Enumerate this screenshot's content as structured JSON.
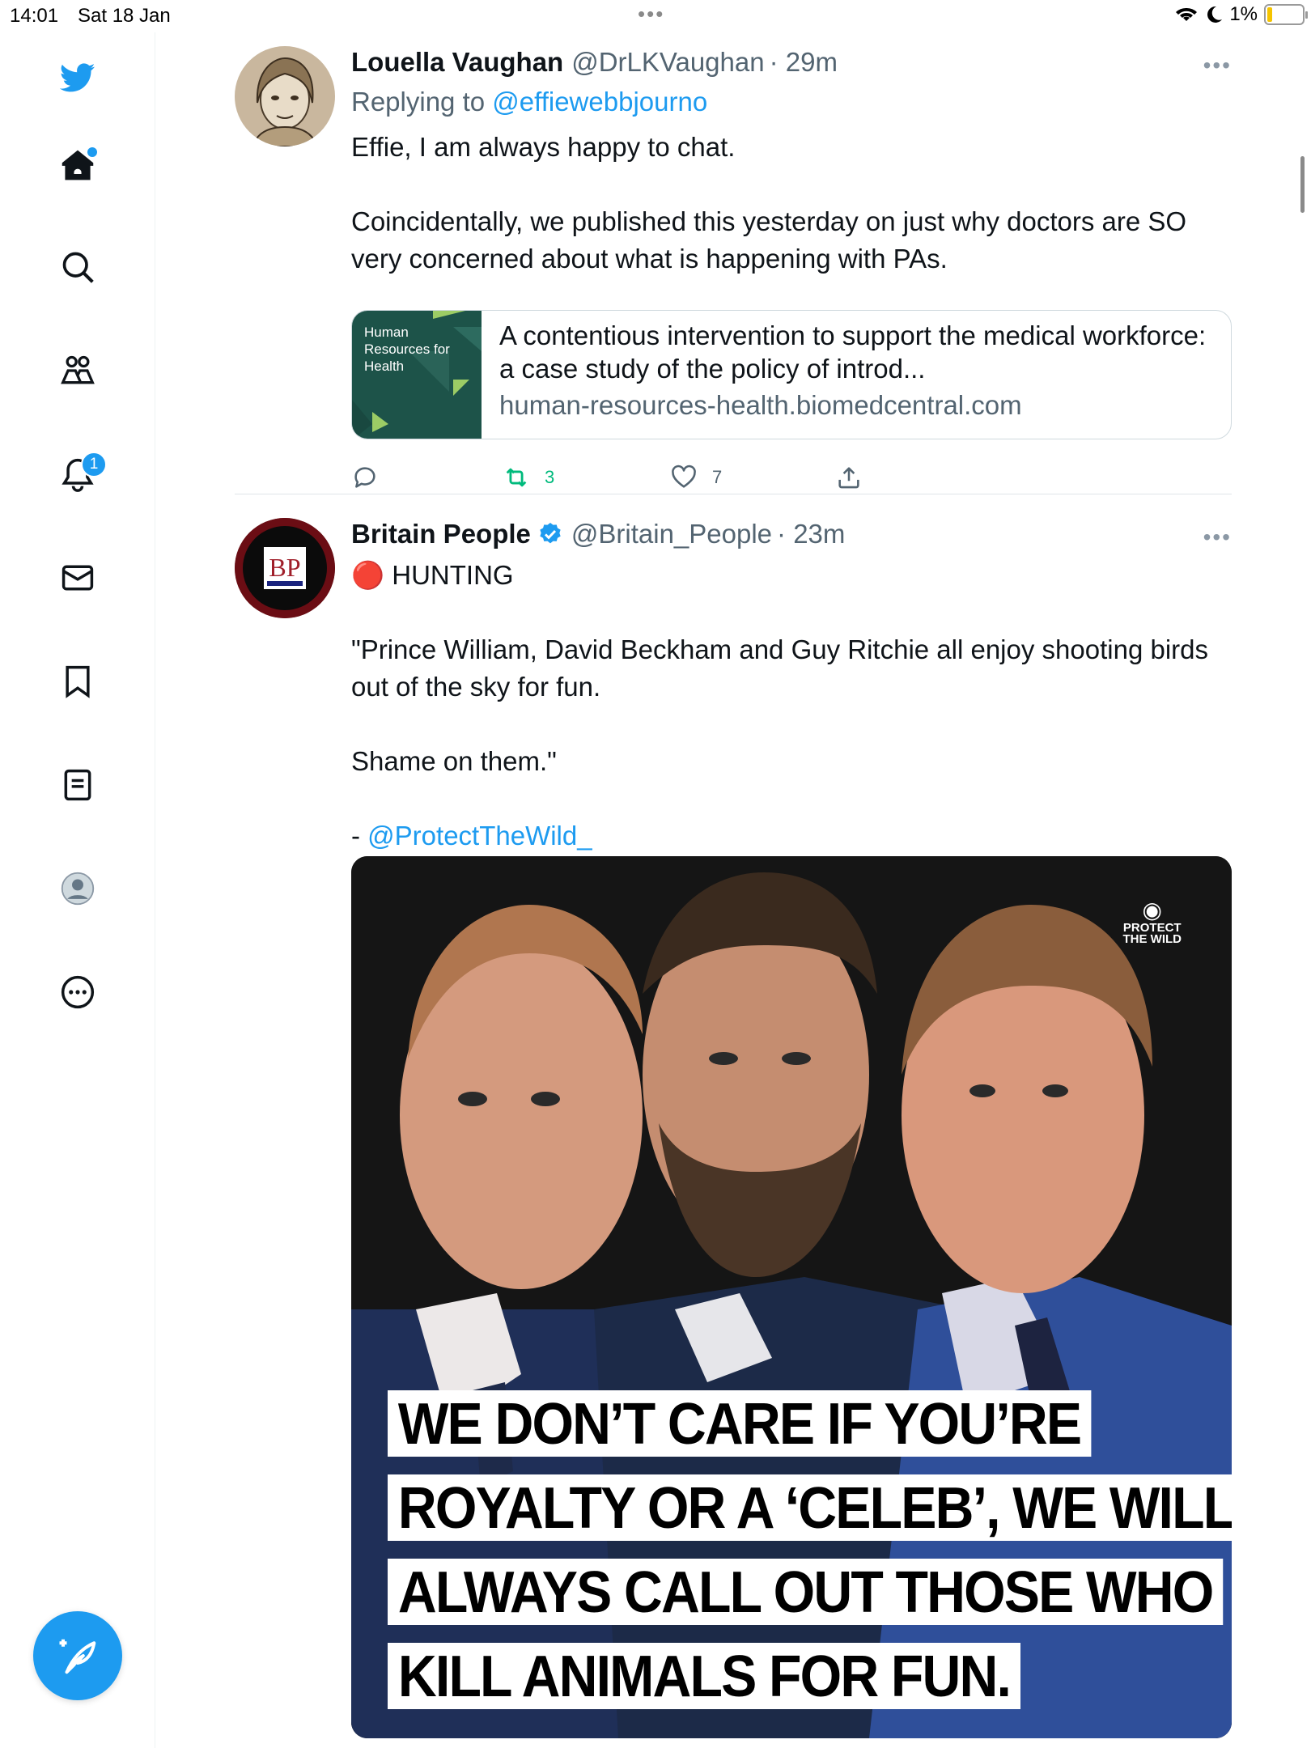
{
  "status_bar": {
    "time": "14:01",
    "date": "Sat 18 Jan",
    "battery": "1%",
    "battery_level": 0.01
  },
  "sidebar": {
    "items": [
      {
        "icon": "twitter-bird-icon"
      },
      {
        "icon": "home-icon"
      },
      {
        "icon": "search-icon"
      },
      {
        "icon": "communities-icon"
      },
      {
        "icon": "notifications-bell-icon",
        "badge": "1"
      },
      {
        "icon": "messages-envelope-icon"
      },
      {
        "icon": "bookmark-icon"
      },
      {
        "icon": "lists-icon"
      },
      {
        "icon": "profile-avatar-icon"
      },
      {
        "icon": "more-circle-icon"
      }
    ],
    "compose_icon": "compose-feather-icon"
  },
  "colors": {
    "accent": "#1d9bf0",
    "text": "#0f1419",
    "secondary": "#536471",
    "retweet_green": "#00ba7c",
    "card_thumb": "#1d5349"
  },
  "tweets": [
    {
      "name": "Louella Vaughan",
      "handle": "@DrLKVaughan",
      "time": "· 29m",
      "replying_label": "Replying to",
      "replying_to": "@effiewebbjourno",
      "text_line1": "Effie, I am always happy to chat.",
      "text_line2": "Coincidentally, we published this yesterday on just why doctors are SO very concerned about what is happening with PAs.",
      "card": {
        "thumb_text": "Human Resources for Health",
        "title": "A contentious intervention to support the medical workforce: a case study of the policy of introd...",
        "domain": "human-resources-health.biomedcentral.com"
      },
      "actions": {
        "replies": "",
        "retweets": "3",
        "likes": "7"
      }
    },
    {
      "name": "Britain People",
      "handle": "@Britain_People",
      "time": "· 23m",
      "verified": true,
      "avatar_text": "BP",
      "line_tag": "🔴 HUNTING",
      "quote_line1": "\"Prince William, David Beckham and Guy Ritchie all enjoy shooting birds out of the sky for fun.",
      "quote_line2": "Shame on them.\"",
      "attribution_prefix": "- ",
      "attribution": "@ProtectTheWild_",
      "media": {
        "logo_line1": "PROTECT",
        "logo_line2": "THE WILD",
        "caption_lines": [
          "WE DON’T CARE IF YOU’RE",
          "ROYALTY OR A ‘CELEB’, WE WILL",
          "ALWAYS CALL OUT THOSE WHO",
          "KILL ANIMALS FOR FUN."
        ]
      }
    }
  ]
}
